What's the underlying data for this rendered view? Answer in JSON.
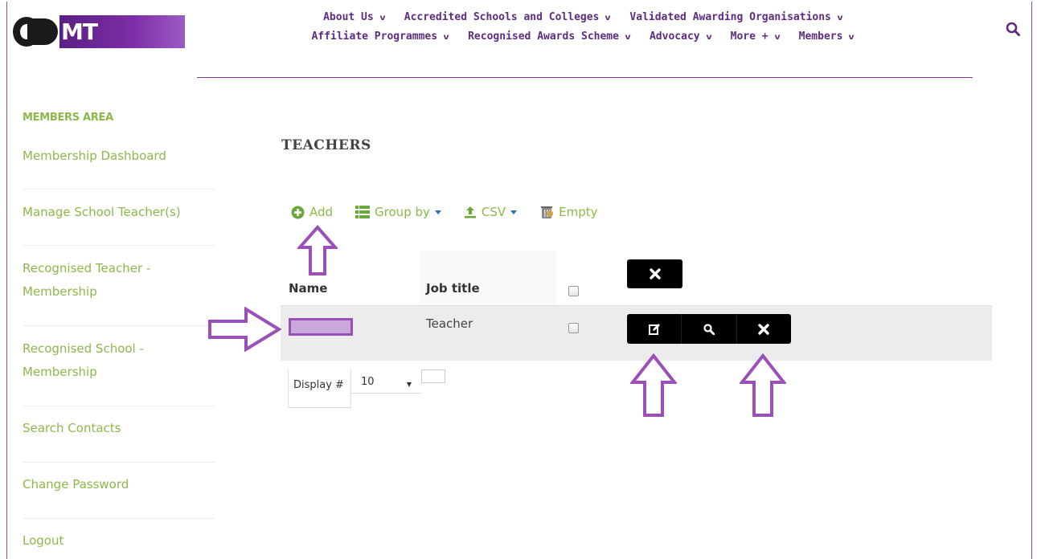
{
  "brand": {
    "logo_text": "MT",
    "logo_full": "CDMT"
  },
  "nav": {
    "row1": [
      "About Us",
      "Accredited Schools and Colleges",
      "Validated Awarding Organisations"
    ],
    "row2": [
      "Affiliate Programmes",
      "Recognised Awards Scheme",
      "Advocacy",
      "More +",
      "Members"
    ],
    "chevron": "⌄"
  },
  "sidebar": {
    "heading": "MEMBERS AREA",
    "items": [
      {
        "label": "Membership Dashboard"
      },
      {
        "label": "Manage School Teacher(s)"
      },
      {
        "label": "Recognised Teacher -\nMembership"
      },
      {
        "label": "Recognised School -\nMembership"
      },
      {
        "label": "Search Contacts"
      },
      {
        "label": "Change Password"
      },
      {
        "label": "Logout"
      }
    ]
  },
  "main": {
    "title": "TEACHERS",
    "toolbar": {
      "add": "Add",
      "group_by": "Group by",
      "csv": "CSV",
      "empty": "Empty"
    },
    "table": {
      "columns": [
        "Name",
        "Job title"
      ],
      "rows": [
        {
          "name": "",
          "job_title": "Teacher"
        }
      ]
    },
    "pager": {
      "label": "Display #",
      "value": "10"
    }
  },
  "colors": {
    "accent_purple": "#5e2b83",
    "link_green": "#8cb84a",
    "annotation": "#9b4fb8"
  },
  "icons": {
    "search": "search-icon",
    "add": "plus-circle-icon",
    "group": "list-icon",
    "csv": "upload-icon",
    "empty": "trash-icon",
    "edit": "edit-icon",
    "view": "magnifier-icon",
    "delete": "close-icon"
  }
}
